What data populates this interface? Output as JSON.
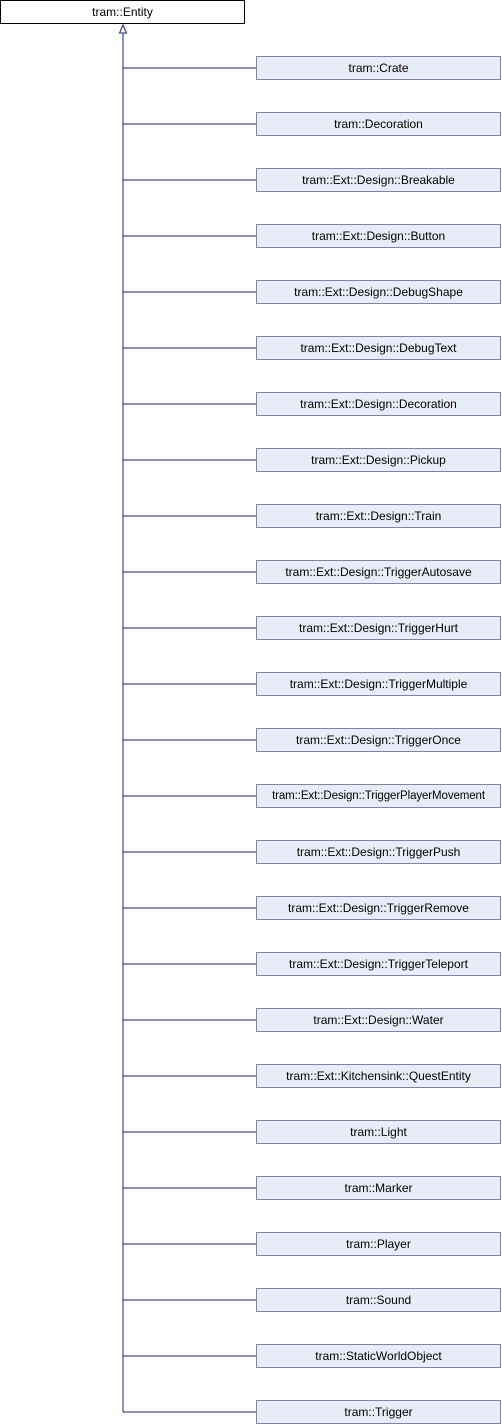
{
  "diagram": {
    "root": "tram::Entity",
    "children": [
      "tram::Crate",
      "tram::Decoration",
      "tram::Ext::Design::Breakable",
      "tram::Ext::Design::Button",
      "tram::Ext::Design::DebugShape",
      "tram::Ext::Design::DebugText",
      "tram::Ext::Design::Decoration",
      "tram::Ext::Design::Pickup",
      "tram::Ext::Design::Train",
      "tram::Ext::Design::TriggerAutosave",
      "tram::Ext::Design::TriggerHurt",
      "tram::Ext::Design::TriggerMultiple",
      "tram::Ext::Design::TriggerOnce",
      "tram::Ext::Design::TriggerPlayerMovement",
      "tram::Ext::Design::TriggerPush",
      "tram::Ext::Design::TriggerRemove",
      "tram::Ext::Design::TriggerTeleport",
      "tram::Ext::Design::Water",
      "tram::Ext::Kitchensink::QuestEntity",
      "tram::Light",
      "tram::Marker",
      "tram::Player",
      "tram::Sound",
      "tram::StaticWorldObject",
      "tram::Trigger"
    ],
    "colors": {
      "edge": "#1a237e",
      "child_fill": "#e8ecf7",
      "child_border": "#7a84b0",
      "root_border": "#000000"
    }
  }
}
